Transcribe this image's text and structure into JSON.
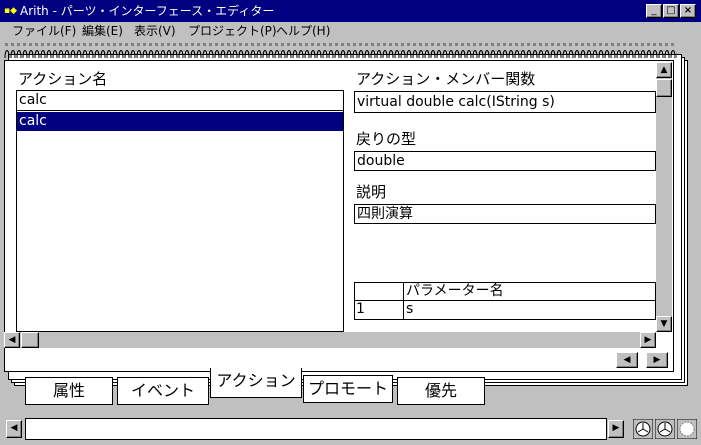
{
  "window": {
    "title": "Arith - パーツ・インターフェース・エディター",
    "icon": "app-icon",
    "min_label": "_",
    "max_label": "□",
    "close_label": "×"
  },
  "menu": [
    {
      "label": "ファイル(F)"
    },
    {
      "label": "編集(E)"
    },
    {
      "label": "表示(V)"
    },
    {
      "label": "プロジェクト(P)"
    },
    {
      "label": "ヘルプ(H)"
    }
  ],
  "actions": {
    "heading": "アクション名",
    "input_value": "calc",
    "items": [
      "calc"
    ]
  },
  "member": {
    "label": "アクション・メンバー関数",
    "value": "virtual double calc(IString s)"
  },
  "return_type": {
    "label": "戻りの型",
    "value": "double"
  },
  "description": {
    "label": "説明",
    "value": "四則演算"
  },
  "params": {
    "header_index": "",
    "header_name": "パラメーター名",
    "rows": [
      {
        "index": "1",
        "name": "s"
      }
    ]
  },
  "tabs": [
    {
      "label": "属性"
    },
    {
      "label": "イベント"
    },
    {
      "label": "アクション",
      "active": true
    },
    {
      "label": "プロモート"
    },
    {
      "label": "優先"
    }
  ],
  "colors": {
    "titlebar": "#000080",
    "selection": "#000080",
    "face": "#c0c0c0"
  }
}
